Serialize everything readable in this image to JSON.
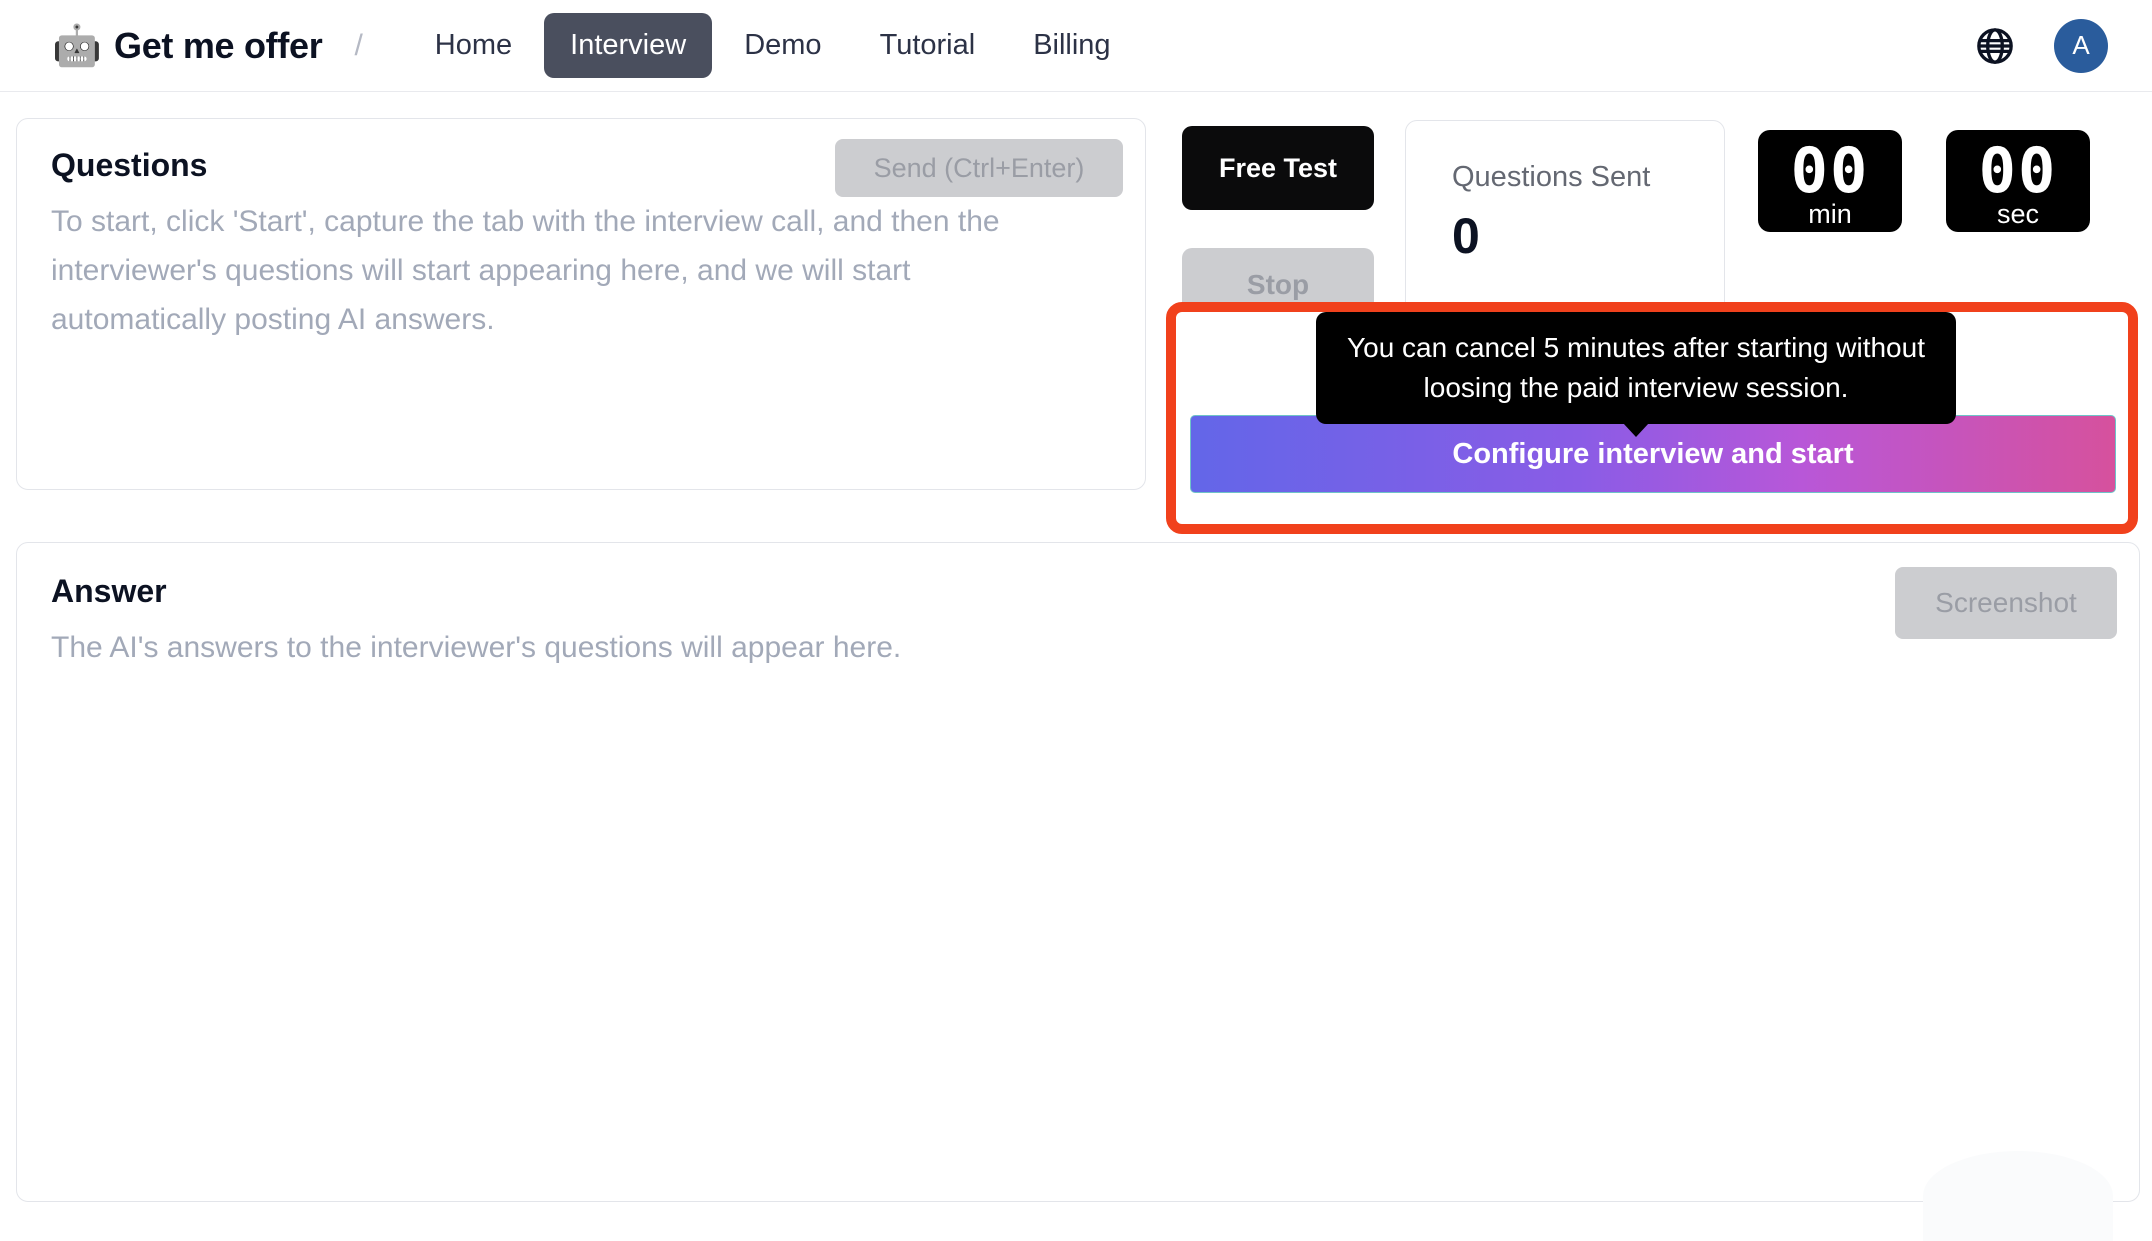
{
  "nav": {
    "brand_logo_icon": "robot-headphones-icon",
    "brand_name": "Get me offer",
    "separator": "/",
    "links": [
      {
        "label": "Home",
        "active": false
      },
      {
        "label": "Interview",
        "active": true
      },
      {
        "label": "Demo",
        "active": false
      },
      {
        "label": "Tutorial",
        "active": false
      },
      {
        "label": "Billing",
        "active": false
      }
    ],
    "language_icon": "globe-icon",
    "avatar_initial": "A",
    "avatar_color": "#2a5c9c",
    "active_tab_bg": "#4a4f5e"
  },
  "questions_panel": {
    "title": "Questions",
    "placeholder": "To start, click 'Start', capture the tab with the interview call, and then the interviewer's questions will start appearing here, and we will start automatically posting AI answers.",
    "send_button": "Send (Ctrl+Enter)",
    "send_button_disabled": true
  },
  "controls": {
    "free_test_button": "Free Test",
    "stop_button": "Stop",
    "stop_button_disabled": true,
    "stat": {
      "label": "Questions Sent",
      "value": "0"
    },
    "timer": {
      "minutes": "00",
      "minutes_unit": "min",
      "seconds": "00",
      "seconds_unit": "sec"
    }
  },
  "highlight": {
    "annotation_color": "#f1411c",
    "tooltip": "You can cancel 5 minutes after starting without loosing the paid interview session.",
    "cta_button": "Configure interview and start",
    "cta_gradient_start": "#6366e8",
    "cta_gradient_end": "#d6519d"
  },
  "answer_panel": {
    "title": "Answer",
    "placeholder": "The AI's answers to the interviewer's questions will appear here.",
    "screenshot_button": "Screenshot",
    "screenshot_button_disabled": true
  }
}
